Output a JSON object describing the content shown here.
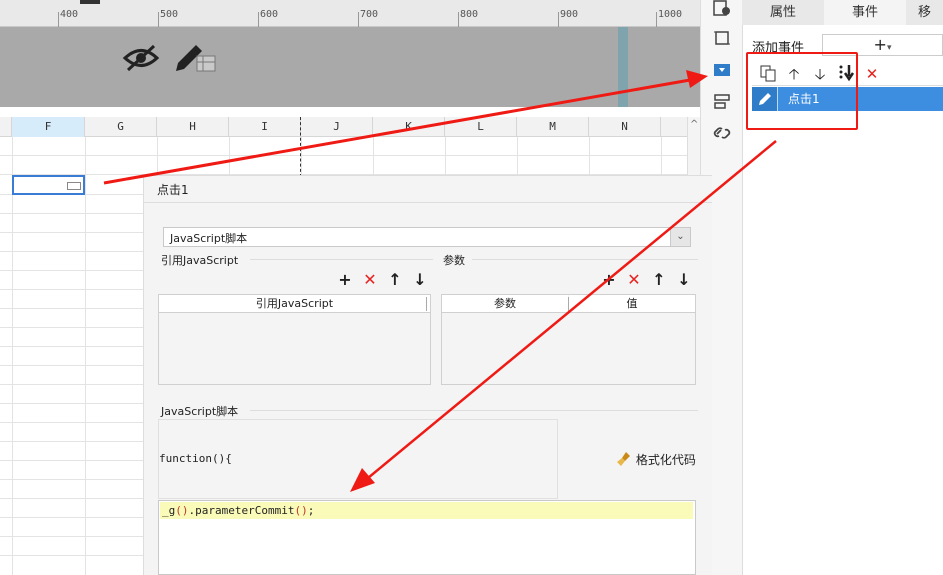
{
  "ruler": {
    "ticks": [
      "400",
      "500",
      "600",
      "700",
      "800",
      "900",
      "1000"
    ]
  },
  "grid": {
    "columns": [
      "F",
      "G",
      "H",
      "I",
      "J",
      "K",
      "L",
      "M",
      "N"
    ],
    "selected_column": "F"
  },
  "right_panel": {
    "tabs": [
      "属性",
      "事件",
      "移"
    ],
    "active_tab": "事件",
    "add_event_label": "添加事件",
    "add_event_button": "+",
    "events": [
      {
        "label": "点击1",
        "selected": true
      }
    ]
  },
  "dialog": {
    "title": "点击1",
    "type_select": "JavaScript脚本",
    "ref_js_section": "引用JavaScript",
    "params_section": "参数",
    "ref_js_table": {
      "columns": [
        "引用JavaScript"
      ]
    },
    "params_table": {
      "columns": [
        "参数",
        "值"
      ]
    },
    "script_section": "JavaScript脚本",
    "function_header": "function(){",
    "format_code_button": "格式化代码",
    "code": {
      "prefix": "_g",
      "paren1": "()",
      "middle": ".parameterCommit",
      "paren2": "()",
      "suffix": ";"
    }
  },
  "colors": {
    "accent": "#3d8ee0",
    "annotation_red": "#f01a14"
  }
}
